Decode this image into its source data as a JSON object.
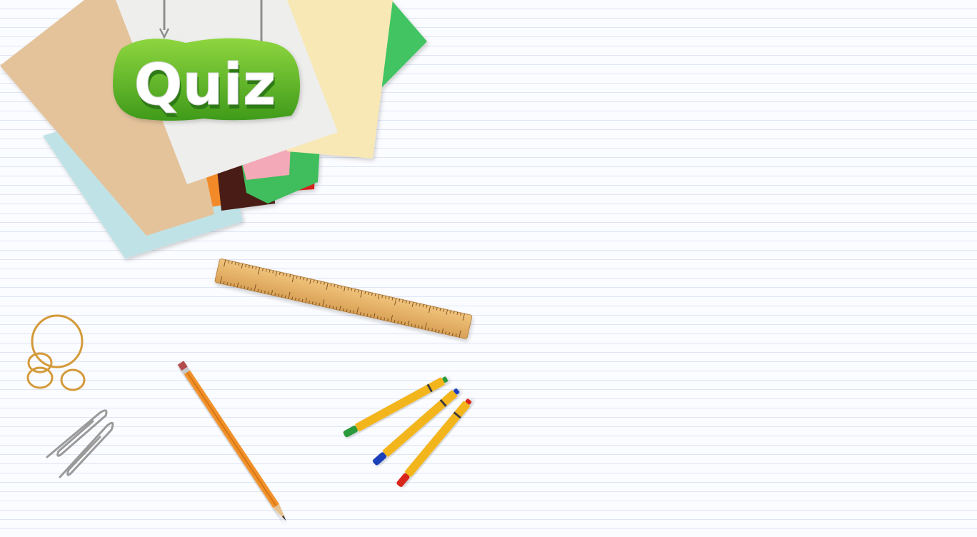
{
  "title": "Quiz",
  "colors": {
    "background": "#fbfcff",
    "rule_lines": "#dfe5f5",
    "quiz_green": "#5fb92b",
    "quiz_text": "#ffffff"
  }
}
